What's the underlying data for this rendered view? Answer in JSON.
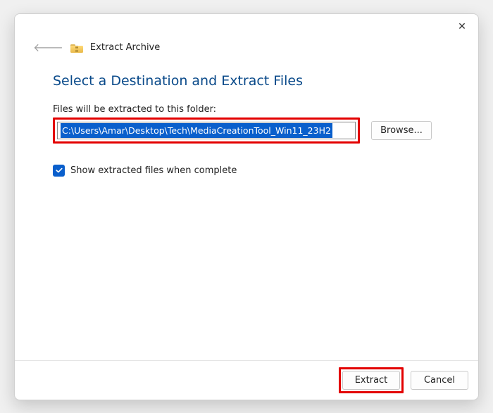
{
  "header": {
    "window_title": "Extract Archive"
  },
  "content": {
    "heading": "Select a Destination and Extract Files",
    "field_label": "Files will be extracted to this folder:",
    "path_value": "C:\\Users\\Amar\\Desktop\\Tech\\MediaCreationTool_Win11_23H2",
    "browse_label": "Browse...",
    "checkbox_checked": true,
    "checkbox_label": "Show extracted files when complete"
  },
  "footer": {
    "extract_label": "Extract",
    "cancel_label": "Cancel"
  },
  "icons": {
    "close": "close-icon",
    "back": "back-arrow-icon",
    "folder": "archive-folder-icon",
    "check": "checkmark-icon"
  },
  "colors": {
    "accent": "#0a5fcc",
    "heading": "#0a4a8a",
    "highlight_box": "#e30000"
  }
}
